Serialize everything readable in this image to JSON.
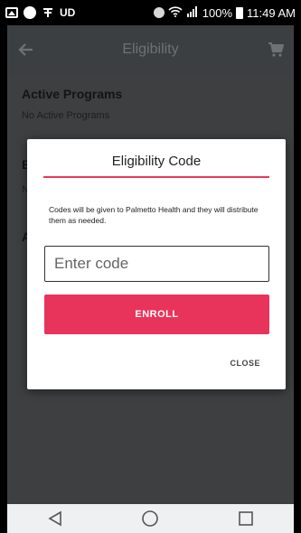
{
  "status_bar": {
    "carrier_badge": "UD",
    "battery_percent": "100%",
    "time": "11:49 AM"
  },
  "app_bar": {
    "title": "Eligibility"
  },
  "content": {
    "sections": [
      {
        "title": "Active Programs",
        "text": "No Active Programs"
      },
      {
        "title": "E",
        "text": "N"
      },
      {
        "title": "A",
        "text": ""
      }
    ]
  },
  "dialog": {
    "title": "Eligibility Code",
    "message": "Codes will be given to Palmetto Health and they will distribute them as needed.",
    "input_placeholder": "Enter code",
    "input_value": "",
    "enroll_label": "ENROLL",
    "close_label": "CLOSE"
  },
  "colors": {
    "accent": "#e8345a",
    "app_bar": "#3b3f42",
    "overlay_content": "#3d3f40"
  },
  "icons": {
    "back": "arrow-left-icon",
    "cart": "shopping-cart-icon",
    "nav_back": "triangle-back-icon",
    "nav_home": "circle-home-icon",
    "nav_recents": "square-recents-icon"
  }
}
